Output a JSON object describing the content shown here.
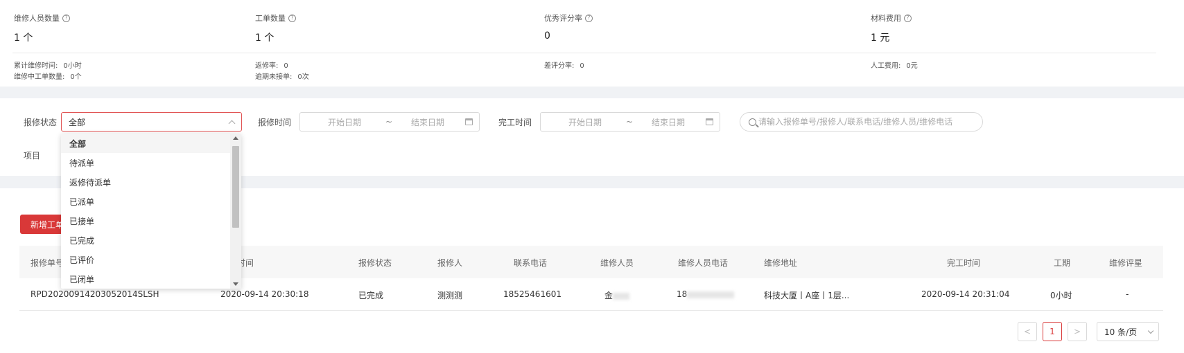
{
  "stats": [
    {
      "label": "维修人员数量",
      "value": "1 个"
    },
    {
      "label": "工单数量",
      "value": "1 个"
    },
    {
      "label": "优秀评分率",
      "value": "0"
    },
    {
      "label": "材料费用",
      "value": "1 元"
    }
  ],
  "sub_stats": [
    {
      "label": "累计维修时间:",
      "value": "0小时"
    },
    {
      "label": "维修中工单数量:",
      "value": "0个"
    },
    {
      "label": "返修率:",
      "value": "0"
    },
    {
      "label": "逾期未接单:",
      "value": "0次"
    },
    {
      "label": "差评分率:",
      "value": "0"
    },
    {
      "label": "人工费用:",
      "value": "0元"
    }
  ],
  "filters": {
    "status_label": "报修状态",
    "status_value": "全部",
    "report_time_label": "报修时间",
    "finish_time_label": "完工时间",
    "start_date_placeholder": "开始日期",
    "end_date_placeholder": "结束日期",
    "date_separator": "~",
    "search_placeholder": "请输入报修单号/报修人/联系电话/维修人员/维修电话",
    "project_label": "项目"
  },
  "dropdown_options": [
    "全部",
    "待派单",
    "返修待派单",
    "已派单",
    "已接单",
    "已完成",
    "已评价",
    "已闭单"
  ],
  "toolbar": {
    "add_label": "新增工单"
  },
  "table": {
    "columns": [
      "报修单号",
      "报修时间",
      "报修状态",
      "报修人",
      "联系电话",
      "维修人员",
      "维修人员电话",
      "维修地址",
      "完工时间",
      "工期",
      "维修评星"
    ],
    "rows": [
      {
        "order_no": "RPD20200914203052014SLSH",
        "report_time": "2020-09-14 20:30:18",
        "status": "已完成",
        "reporter": "测测测",
        "phone": "18525461601",
        "repairer": "金",
        "repairer_phone": "18",
        "address": "科技大厦丨A座丨1层...",
        "finish_time": "2020-09-14 20:31:04",
        "duration": "0小时",
        "rating": "-"
      }
    ]
  },
  "pagination": {
    "prev": "<",
    "current": "1",
    "next": ">",
    "page_size": "10 条/页"
  }
}
